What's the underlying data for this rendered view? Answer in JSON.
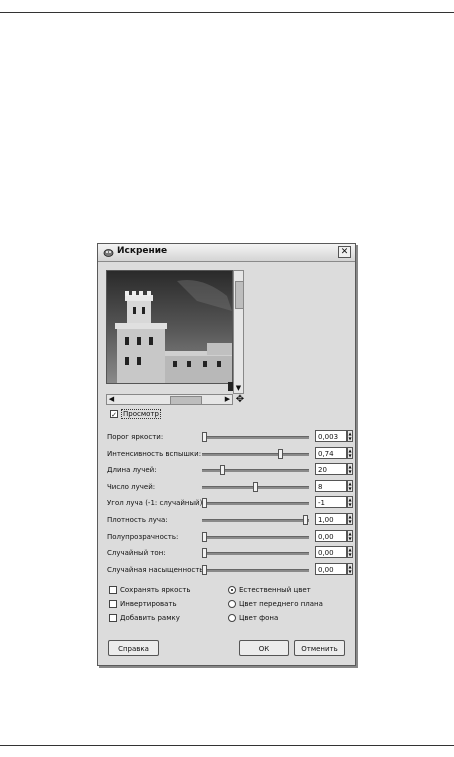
{
  "window": {
    "title": "Искрение",
    "close_label": "✕"
  },
  "preview": {
    "checkbox_label": "Просмотр",
    "checked": true
  },
  "params": [
    {
      "label": "Порог яркости:",
      "value": "0,003",
      "level": 0.03
    },
    {
      "label": "Интенсивность вспышки:",
      "value": "0,74",
      "level": 0.74
    },
    {
      "label": "Длина лучей:",
      "value": "20",
      "level": 0.2
    },
    {
      "label": "Число лучей:",
      "value": "8",
      "level": 0.5
    },
    {
      "label": "Угол луча (-1: случайный):",
      "value": "-1",
      "level": 0.0
    },
    {
      "label": "Плотность луча:",
      "value": "1,00",
      "level": 1.0
    },
    {
      "label": "Полупрозрачность:",
      "value": "0,00",
      "level": 0.0
    },
    {
      "label": "Случайный тон:",
      "value": "0,00",
      "level": 0.0
    },
    {
      "label": "Случайная насыщенность:",
      "value": "0,00",
      "level": 0.0
    }
  ],
  "checkboxes": [
    {
      "label": "Сохранять яркость",
      "checked": false
    },
    {
      "label": "Инвертировать",
      "checked": false
    },
    {
      "label": "Добавить рамку",
      "checked": false
    }
  ],
  "radios": [
    {
      "label": "Естественный цвет",
      "selected": true
    },
    {
      "label": "Цвет переднего плана",
      "selected": false
    },
    {
      "label": "Цвет фона",
      "selected": false
    }
  ],
  "buttons": {
    "help": "Справка",
    "ok": "ОК",
    "cancel": "Отменить"
  }
}
